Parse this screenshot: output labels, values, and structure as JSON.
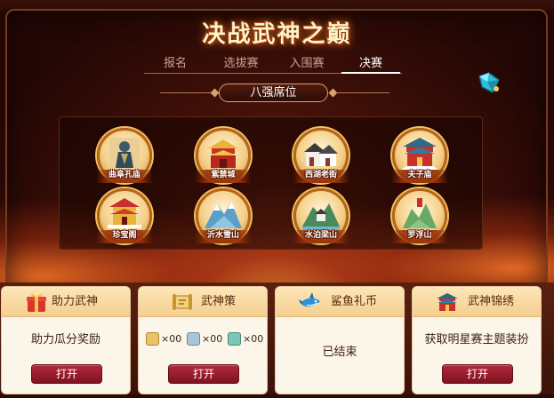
{
  "title": "决战武神之巅",
  "tabs": [
    {
      "label": "报名",
      "active": false
    },
    {
      "label": "选拔赛",
      "active": false
    },
    {
      "label": "入围赛",
      "active": false
    },
    {
      "label": "决赛",
      "active": true
    }
  ],
  "section_label": "八强席位",
  "venues": [
    {
      "name": "曲阜孔庙",
      "icon": "confucius-statue-icon"
    },
    {
      "name": "紫禁城",
      "icon": "forbidden-city-icon"
    },
    {
      "name": "西湖老街",
      "icon": "old-street-icon"
    },
    {
      "name": "夫子庙",
      "icon": "confucius-temple-icon"
    },
    {
      "name": "珍宝阁",
      "icon": "treasure-pavilion-icon"
    },
    {
      "name": "沂水雪山",
      "icon": "snow-mountain-icon"
    },
    {
      "name": "水泊梁山",
      "icon": "liangshan-icon"
    },
    {
      "name": "罗浮山",
      "icon": "luofu-mountain-icon"
    }
  ],
  "cards": [
    {
      "title": "助力武神",
      "icon": "gift-box-icon",
      "body": "助力瓜分奖励",
      "button": "打开"
    },
    {
      "title": "武神策",
      "icon": "scroll-icon",
      "tokens": [
        {
          "icon": "gold-token-icon",
          "count": "×00",
          "color": "#e9c36a"
        },
        {
          "icon": "silver-token-icon",
          "count": "×00",
          "color": "#a9c6d6"
        },
        {
          "icon": "jade-token-icon",
          "count": "×00",
          "color": "#7fc4b8"
        }
      ],
      "button": "打开"
    },
    {
      "title": "鲨鱼礼币",
      "icon": "shark-icon",
      "body": "已结束"
    },
    {
      "title": "武神锦绣",
      "icon": "pavilion-icon",
      "body": "获取明星赛主题装扮",
      "button": "打开"
    }
  ],
  "colors": {
    "accent": "#9b1e2e",
    "card_bg": "#fbf5ea",
    "title_glow": "#ff8a2a"
  }
}
